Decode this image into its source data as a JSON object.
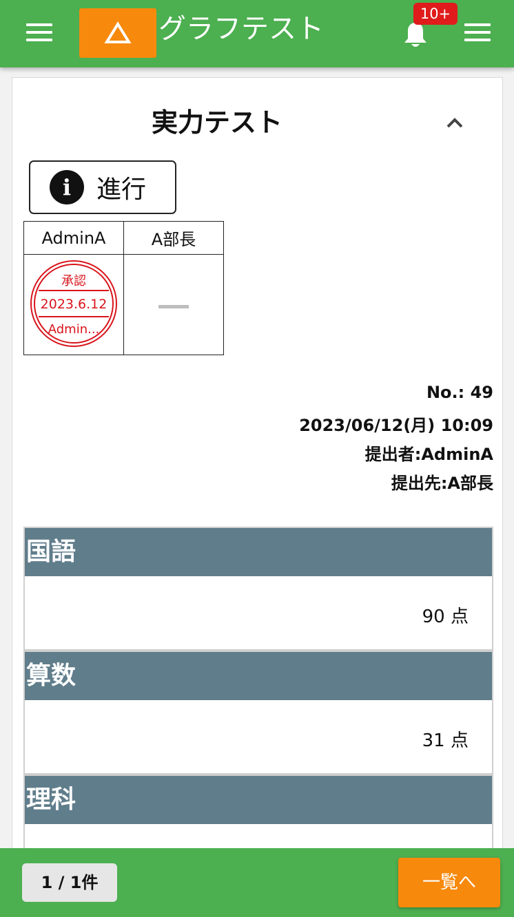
{
  "header": {
    "app_title": "グラフテスト",
    "notification_badge": "10+",
    "menu_icon": "hamburger-icon",
    "notification_icon": "bell-icon",
    "logo_icon": "triangle-logo-icon",
    "colors": {
      "bar": "#4caf50",
      "logo": "#f7890c",
      "badge": "#e01b1b"
    }
  },
  "document": {
    "title": "実力テスト",
    "collapse_icon": "chevron-up-icon",
    "status": {
      "icon": "info-icon",
      "label": "進行"
    },
    "approvers": [
      {
        "name": "AdminA",
        "stamp": {
          "label": "承認",
          "date": "2023.6.12",
          "user": "Admin..."
        }
      },
      {
        "name": "A部長",
        "stamp_placeholder": "—"
      }
    ],
    "meta": {
      "number": "No.: 49",
      "datetime": "2023/06/12(月) 10:09",
      "submitter": "提出者:AdminA",
      "recipient": "提出先:A部長"
    },
    "sections": [
      {
        "label": "国語",
        "score": "90 点"
      },
      {
        "label": "算数",
        "score": "31 点"
      },
      {
        "label": "理科",
        "score": ""
      }
    ],
    "section_header_color": "#607d8b",
    "stamp_color": "#d9141b"
  },
  "footer": {
    "pager": "1 / 1件",
    "list_button": "一覧へ"
  }
}
